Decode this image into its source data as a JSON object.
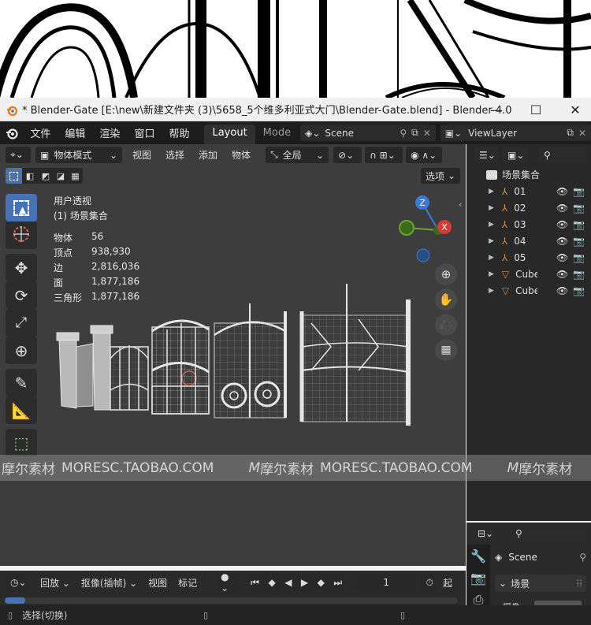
{
  "window": {
    "title": "* Blender-Gate [E:\\new\\新建文件夹 (3)\\5658_5个维多利亚式大门\\Blender-Gate.blend] - Blender 4.0",
    "minimize": "—",
    "maximize": "☐",
    "close": "✕"
  },
  "menu": [
    "文件",
    "编辑",
    "渲染",
    "窗口",
    "帮助"
  ],
  "workspaces": {
    "active": "Layout",
    "next": "Mode"
  },
  "scene": {
    "name": "Scene"
  },
  "viewlayer": {
    "name": "ViewLayer"
  },
  "viewport_header": {
    "mode": "物体模式",
    "menus": [
      "视图",
      "选择",
      "添加",
      "物体"
    ],
    "transform": "全局",
    "options": "选项"
  },
  "overlay": {
    "view_name": "用户透视",
    "collection": "(1) 场景集合",
    "stats": [
      {
        "label": "物体",
        "value": "56"
      },
      {
        "label": "顶点",
        "value": "938,930"
      },
      {
        "label": "边",
        "value": "2,816,036"
      },
      {
        "label": "面",
        "value": "1,877,186"
      },
      {
        "label": "三角形",
        "value": "1,877,186"
      }
    ]
  },
  "gizmo": {
    "z": "Z",
    "x": "X"
  },
  "outliner": {
    "root": "场景集合",
    "items": [
      {
        "name": "01",
        "type": "armature"
      },
      {
        "name": "02",
        "type": "armature"
      },
      {
        "name": "03",
        "type": "armature"
      },
      {
        "name": "04",
        "type": "armature"
      },
      {
        "name": "05",
        "type": "armature"
      },
      {
        "name": "Cube",
        "type": "mesh"
      },
      {
        "name": "Cube",
        "type": "mesh"
      }
    ]
  },
  "properties": {
    "scene_label": "Scene",
    "section": "场景",
    "camera_label": "摄像"
  },
  "timeline": {
    "playback": "回放",
    "keying": "抠像(插帧)",
    "view": "视图",
    "marker": "标记",
    "current_frame": "1",
    "start_label": "起"
  },
  "status": {
    "select_hint": "选择(切换)"
  },
  "watermark": {
    "segments": [
      "摩尔素材",
      "MORESC.TAOBAO.COM",
      "摩尔素材",
      "MORESC.TAOBAO.COM",
      "摩尔素材"
    ]
  },
  "colors": {
    "accent": "#4772b3",
    "x_axis": "#d83a3a",
    "y_axis": "#6ba52a",
    "z_axis": "#3b7bd4"
  }
}
